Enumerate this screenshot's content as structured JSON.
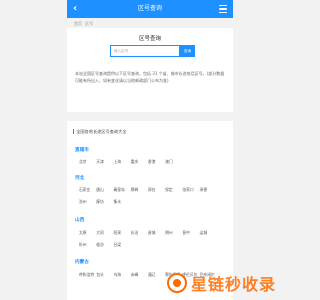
{
  "header": {
    "back_label": "‹",
    "title": "区号查询"
  },
  "breadcrumb": [
    "首页",
    "区号"
  ],
  "search": {
    "title": "区号查询",
    "placeholder": "输入区号",
    "button": "查询",
    "description": "本站全国区号查询提供以下区号查询，包括 31 个省、城市长途电话区号。(部分数据可能有所出入，如有变化请以当地邮政部门公布为准)"
  },
  "list_title": "全国各地长途区号查询大全",
  "provinces": [
    {
      "name": "直辖市",
      "cities": [
        "北京",
        "天津",
        "上海",
        "重庆",
        "香港",
        "澳门"
      ]
    },
    {
      "name": "河北",
      "cities": [
        "石家庄",
        "唐山",
        "秦皇岛",
        "邯郸",
        "邢台",
        "保定",
        "张家口",
        "承德",
        "沧州",
        "廊坊",
        "衡水"
      ]
    },
    {
      "name": "山西",
      "cities": [
        "太原",
        "大同",
        "阳泉",
        "长治",
        "晋城",
        "朔州",
        "晋中",
        "运城",
        "忻州",
        "临汾",
        "吕梁"
      ]
    },
    {
      "name": "内蒙古",
      "cities": [
        "呼和浩特",
        "包头",
        "乌海",
        "赤峰",
        "通辽",
        "鄂尔多斯",
        "呼伦贝尔",
        "巴彦淖尔"
      ]
    }
  ],
  "watermark": {
    "text": "星链秒收录"
  },
  "colors": {
    "primary": "#1e90ff",
    "watermark": "#ff6a00"
  }
}
